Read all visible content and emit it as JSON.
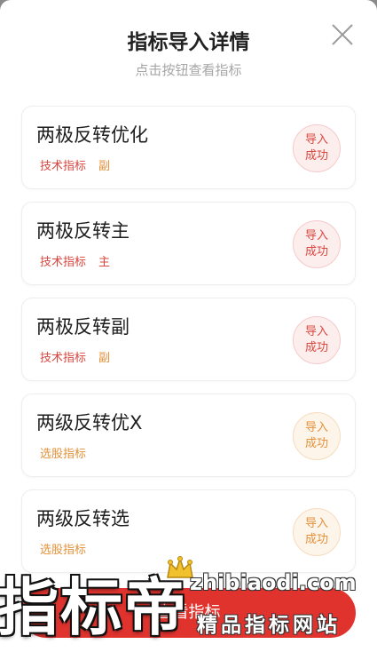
{
  "header": {
    "title": "指标导入详情",
    "subtitle": "点击按钮查看指标"
  },
  "items": [
    {
      "name": "两极反转优化",
      "tags": [
        "技术指标",
        "副"
      ],
      "status": [
        "导入",
        "成功"
      ],
      "tone": "red"
    },
    {
      "name": "两极反转主",
      "tags": [
        "技术指标",
        "主"
      ],
      "status": [
        "导入",
        "成功"
      ],
      "tone": "red"
    },
    {
      "name": "两极反转副",
      "tags": [
        "技术指标",
        "副"
      ],
      "status": [
        "导入",
        "成功"
      ],
      "tone": "red"
    },
    {
      "name": "两级反转优X",
      "tags": [
        "选股指标"
      ],
      "status": [
        "导入",
        "成功"
      ],
      "tone": "orange"
    },
    {
      "name": "两级反转选",
      "tags": [
        "选股指标"
      ],
      "status": [
        "导入",
        "成功"
      ],
      "tone": "orange"
    }
  ],
  "bottom_button": {
    "label": "查看指标"
  },
  "watermark": {
    "brand": "指标帝",
    "domain": "zhibiaodi.com",
    "tagline": "精品指标网站"
  },
  "colors": {
    "red": "#d9463e",
    "orange": "#e3913a",
    "button": "#e0332e"
  }
}
